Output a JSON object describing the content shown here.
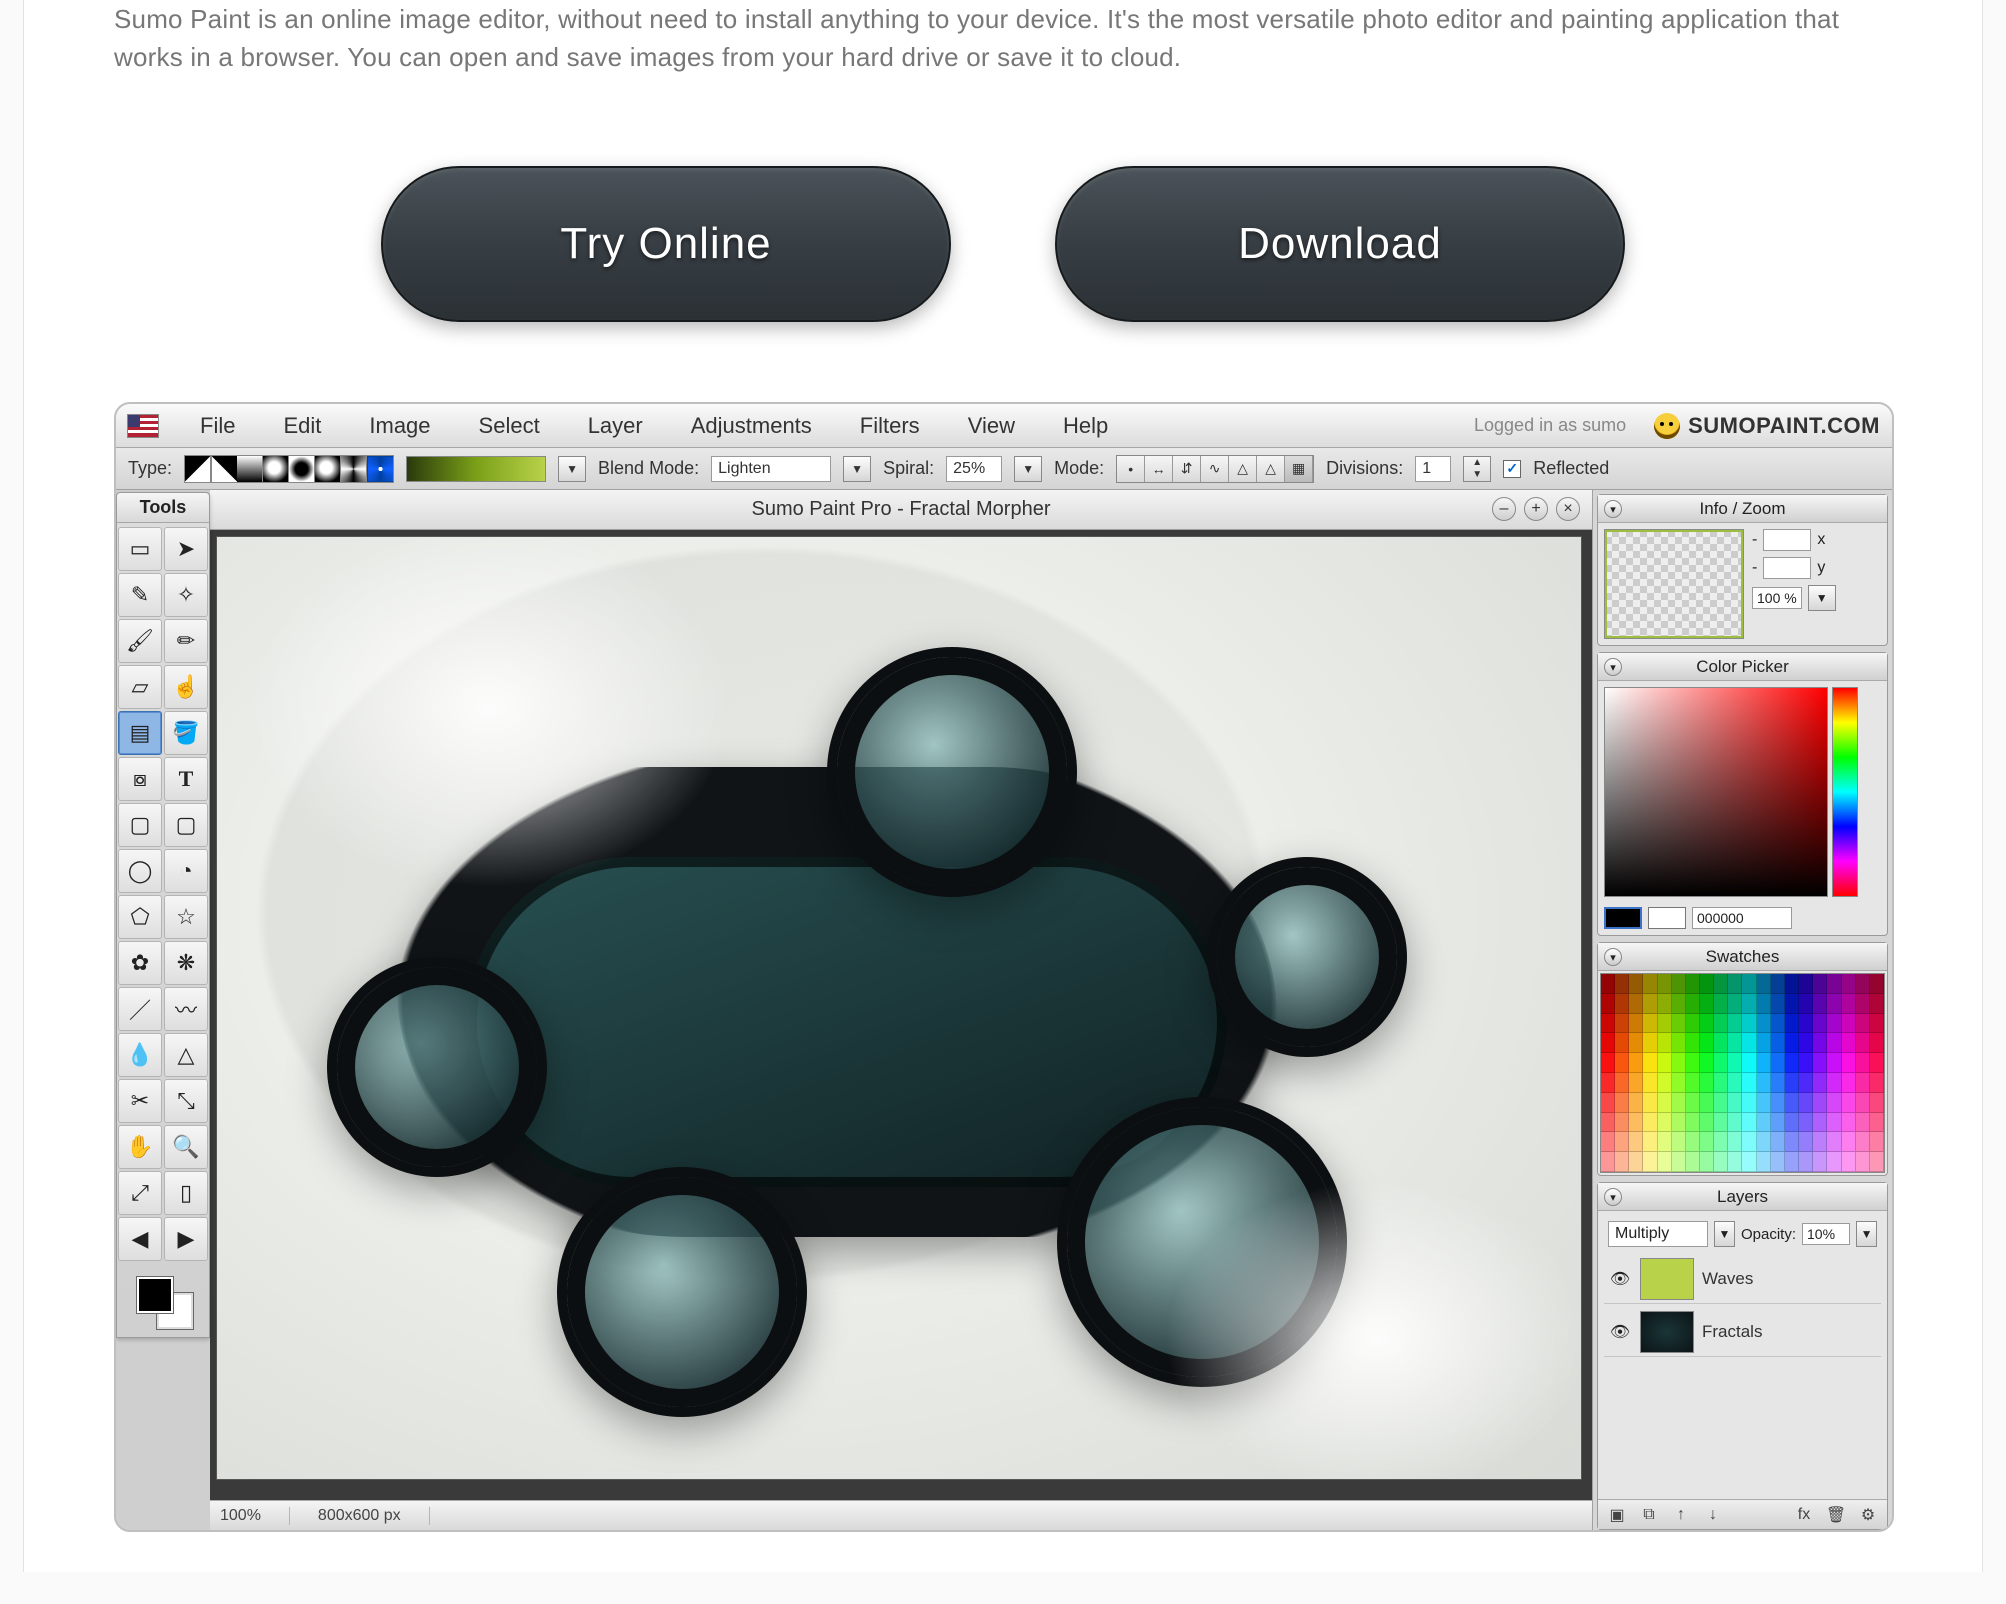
{
  "intro": "Sumo Paint is an online image editor, without need to install anything to your device. It's the most versatile photo editor and painting application that works in a browser. You can open and save images from your hard drive or save it to cloud.",
  "cta": {
    "try": "Try Online",
    "download": "Download"
  },
  "menu": {
    "items": [
      "File",
      "Edit",
      "Image",
      "Select",
      "Layer",
      "Adjustments",
      "Filters",
      "View",
      "Help"
    ],
    "logged_in": "Logged in as sumo",
    "brand": "SUMOPAINT.COM"
  },
  "options": {
    "type_label": "Type:",
    "blend_label": "Blend Mode:",
    "blend_value": "Lighten",
    "spiral_label": "Spiral:",
    "spiral_value": "25%",
    "mode_label": "Mode:",
    "divisions_label": "Divisions:",
    "divisions_value": "1",
    "reflected_label": "Reflected"
  },
  "tools_title": "Tools",
  "doc_title": "Sumo Paint Pro - Fractal Morpher",
  "status": {
    "zoom": "100%",
    "dims": "800x600 px"
  },
  "panels": {
    "info_title": "Info / Zoom",
    "info_x_suffix": "x",
    "info_y_suffix": "y",
    "info_zoom": "100 %",
    "picker_title": "Color Picker",
    "picker_hex": "000000",
    "swatches_title": "Swatches",
    "layers_title": "Layers",
    "layer_blend": "Multiply",
    "opacity_label": "Opacity:",
    "opacity_value": "10%",
    "layers": [
      {
        "name": "Waves"
      },
      {
        "name": "Fractals"
      }
    ]
  },
  "colors": {
    "accent_green": "#8fbf1f",
    "fg": "#000000",
    "bg": "#ffffff"
  }
}
